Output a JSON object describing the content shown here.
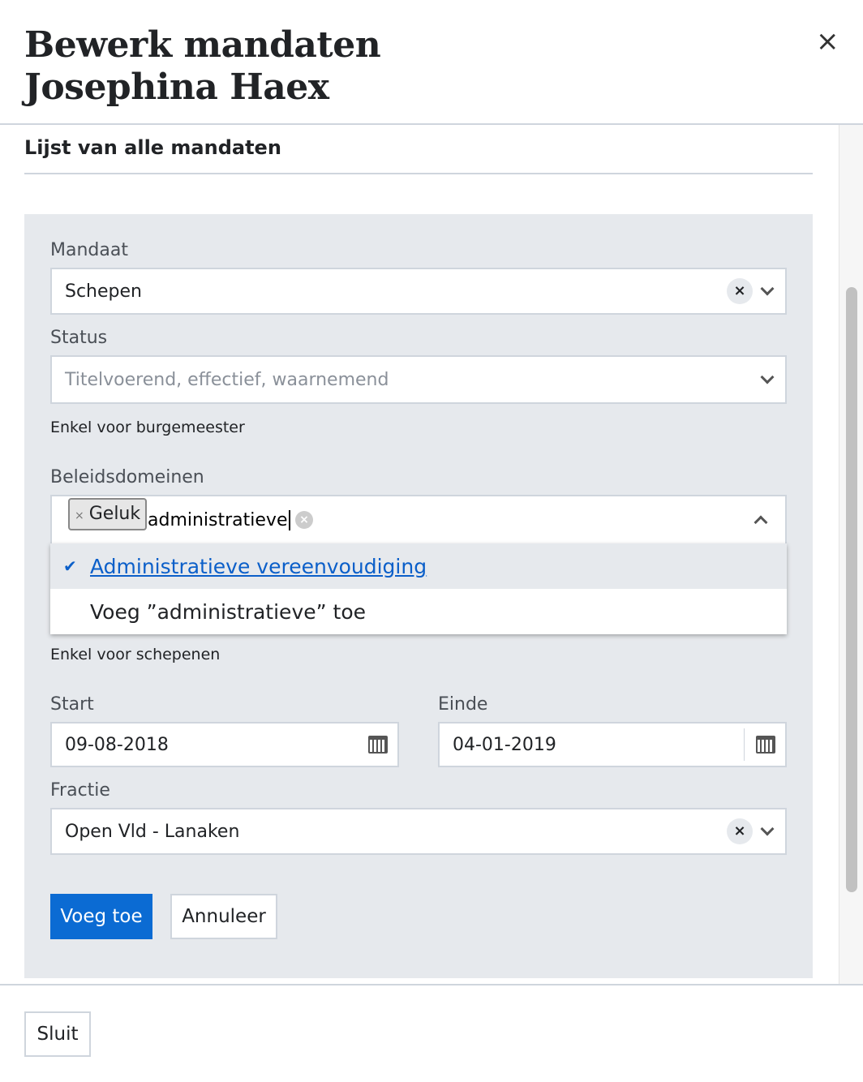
{
  "header": {
    "title_line1": "Bewerk mandaten",
    "title_line2": "Josephina Haex",
    "close_icon": "×"
  },
  "section": {
    "title": "Lijst van alle mandaten"
  },
  "form": {
    "mandaat": {
      "label": "Mandaat",
      "value": "Schepen"
    },
    "status": {
      "label": "Status",
      "placeholder": "Titelvoerend, effectief, waarnemend",
      "hint": "Enkel voor burgemeester"
    },
    "beleidsdomeinen": {
      "label": "Beleidsdomeinen",
      "tags": [
        "Geluk"
      ],
      "search": "administratieve",
      "options": [
        "Administratieve vereenvoudiging",
        "Voeg ”administratieve” toe"
      ],
      "hint": "Enkel voor schepenen"
    },
    "start": {
      "label": "Start",
      "value": "09-08-2018"
    },
    "einde": {
      "label": "Einde",
      "value": "04-01-2019"
    },
    "fractie": {
      "label": "Fractie",
      "value": "Open Vld - Lanaken"
    },
    "add_label": "Voeg toe",
    "cancel_label": "Annuleer"
  },
  "footer": {
    "close_label": "Sluit"
  }
}
